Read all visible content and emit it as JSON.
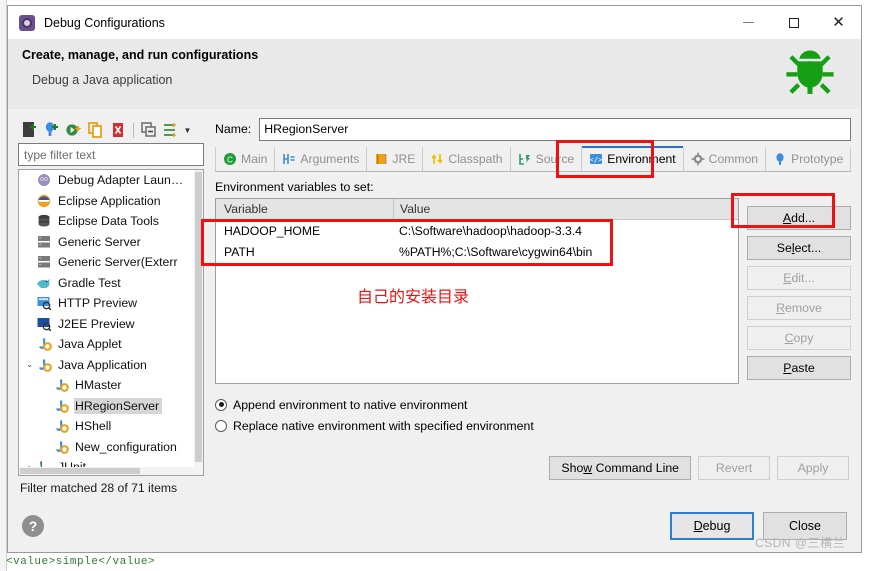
{
  "window": {
    "title": "Debug Configurations",
    "icon": "debug-configurations-icon",
    "minimize": "minimize-icon",
    "maximize": "maximize-icon",
    "close": "close-icon"
  },
  "header": {
    "title": "Create, manage, and run configurations",
    "subtitle": "Debug a Java application",
    "icon": "green-bug-icon"
  },
  "sidebar": {
    "toolbar": [
      {
        "name": "new-configuration-icon"
      },
      {
        "name": "new-prototype-icon"
      },
      {
        "name": "export-configuration-icon"
      },
      {
        "name": "duplicate-icon"
      },
      {
        "name": "delete-icon"
      },
      {
        "name": "collapse-all-icon"
      },
      {
        "name": "filter-icon"
      }
    ],
    "filter_placeholder": "type filter text",
    "filter_value": "",
    "tree": [
      {
        "label": "Debug Adapter Laun…",
        "icon": "debug-adapter-icon",
        "indent": 1,
        "twisty": "",
        "selected": false
      },
      {
        "label": "Eclipse Application",
        "icon": "eclipse-application-icon",
        "indent": 1,
        "twisty": "",
        "selected": false
      },
      {
        "label": "Eclipse Data Tools",
        "icon": "eclipse-data-tools-icon",
        "indent": 1,
        "twisty": "",
        "selected": false
      },
      {
        "label": "Generic Server",
        "icon": "generic-server-icon",
        "indent": 1,
        "twisty": "",
        "selected": false
      },
      {
        "label": "Generic Server(Exterr",
        "icon": "generic-server-external-icon",
        "indent": 1,
        "twisty": "",
        "selected": false
      },
      {
        "label": "Gradle Test",
        "icon": "gradle-test-icon",
        "indent": 1,
        "twisty": "",
        "selected": false
      },
      {
        "label": "HTTP Preview",
        "icon": "http-preview-icon",
        "indent": 1,
        "twisty": "",
        "selected": false
      },
      {
        "label": "J2EE Preview",
        "icon": "j2ee-preview-icon",
        "indent": 1,
        "twisty": "",
        "selected": false
      },
      {
        "label": "Java Applet",
        "icon": "java-applet-icon",
        "indent": 1,
        "twisty": "",
        "selected": false
      },
      {
        "label": "Java Application",
        "icon": "java-application-icon",
        "indent": 0,
        "twisty": "⌄",
        "selected": false
      },
      {
        "label": "HMaster",
        "icon": "java-application-icon",
        "indent": 2,
        "twisty": "",
        "selected": false
      },
      {
        "label": "HRegionServer",
        "icon": "java-application-icon",
        "indent": 2,
        "twisty": "",
        "selected": true
      },
      {
        "label": "HShell",
        "icon": "java-application-icon",
        "indent": 2,
        "twisty": "",
        "selected": false
      },
      {
        "label": "New_configuration",
        "icon": "java-application-icon",
        "indent": 2,
        "twisty": "",
        "selected": false
      },
      {
        "label": "JUnit",
        "icon": "junit-icon",
        "indent": 0,
        "twisty": "›",
        "selected": false
      }
    ],
    "filter_status": "Filter matched 28 of 71 items"
  },
  "config": {
    "name_label": "Name:",
    "name_value": "HRegionServer",
    "tabs": [
      {
        "label": "Main",
        "icon": "main-tab-icon",
        "active": false
      },
      {
        "label": "Arguments",
        "icon": "arguments-tab-icon",
        "active": false
      },
      {
        "label": "JRE",
        "icon": "jre-tab-icon",
        "active": false
      },
      {
        "label": "Classpath",
        "icon": "classpath-tab-icon",
        "active": false
      },
      {
        "label": "Source",
        "icon": "source-tab-icon",
        "active": false
      },
      {
        "label": "Environment",
        "icon": "environment-tab-icon",
        "active": true
      },
      {
        "label": "Common",
        "icon": "common-tab-icon",
        "active": false
      },
      {
        "label": "Prototype",
        "icon": "prototype-tab-icon",
        "active": false
      }
    ]
  },
  "environment": {
    "section_label": "Environment variables to set:",
    "columns": [
      "Variable",
      "Value"
    ],
    "rows": [
      {
        "variable": "HADOOP_HOME",
        "value": "C:\\Software\\hadoop\\hadoop-3.3.4"
      },
      {
        "variable": "PATH",
        "value": "%PATH%;C:\\Software\\cygwin64\\bin"
      }
    ],
    "buttons": [
      {
        "label": "Add...",
        "mnemonic": "A",
        "enabled": true
      },
      {
        "label": "Select...",
        "mnemonic": "l",
        "enabled": true
      },
      {
        "label": "Edit...",
        "mnemonic": "E",
        "enabled": false
      },
      {
        "label": "Remove",
        "mnemonic": "R",
        "enabled": false
      },
      {
        "label": "Copy",
        "mnemonic": "C",
        "enabled": false
      },
      {
        "label": "Paste",
        "mnemonic": "P",
        "enabled": true
      }
    ],
    "radios": [
      {
        "label": "Append environment to native environment",
        "selected": true
      },
      {
        "label": "Replace native environment with specified environment",
        "selected": false
      }
    ]
  },
  "actions": {
    "show_command_line": "Show Command Line",
    "revert": "Revert",
    "revert_enabled": false,
    "apply": "Apply",
    "apply_enabled": false,
    "debug": "Debug",
    "close": "Close",
    "help_icon": "help-icon"
  },
  "annotations": {
    "environment_tab_note": "",
    "table_note": "",
    "add_button_note": "",
    "chinese_note": "自己的安装目录",
    "color": "#ee1111"
  },
  "background": {
    "editor_fragment": "<value>simple</value>"
  },
  "watermark": "CSDN @三横兰"
}
